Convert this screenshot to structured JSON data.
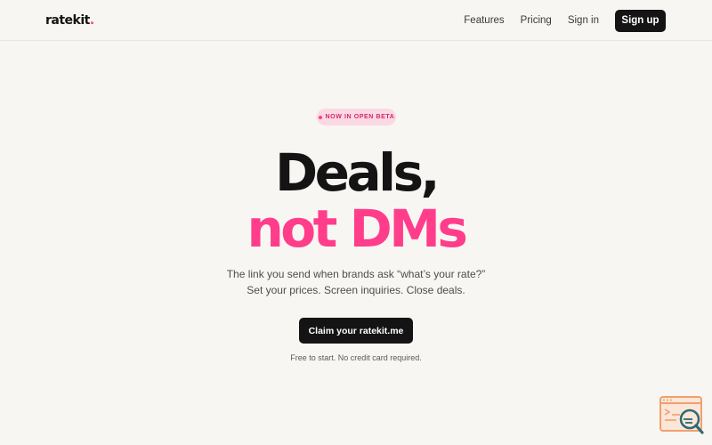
{
  "nav": {
    "logo_text": "ratekit",
    "logo_dot": ".",
    "links": [
      "Features",
      "Pricing",
      "Sign in"
    ],
    "signup_label": "Sign up"
  },
  "hero": {
    "badge": "NOW IN OPEN BETA",
    "headline_line1": "Deals,",
    "headline_line2": "not DMs",
    "subtitle": "The link you send when brands ask “what’s your rate?” Set your prices. Screen inquiries. Close deals.",
    "cta_label": "Claim your ratekit.me",
    "fine_print": "Free to start. No credit card required."
  },
  "widget": {
    "icon": "search-feedback-icon"
  },
  "colors": {
    "background": "#f8f6f2",
    "ink": "#141414",
    "accent_pink": "#ff3d8b",
    "badge_bg": "#fbd9e4",
    "widget_orange": "#f0a070",
    "widget_teal": "#2d6b73"
  }
}
